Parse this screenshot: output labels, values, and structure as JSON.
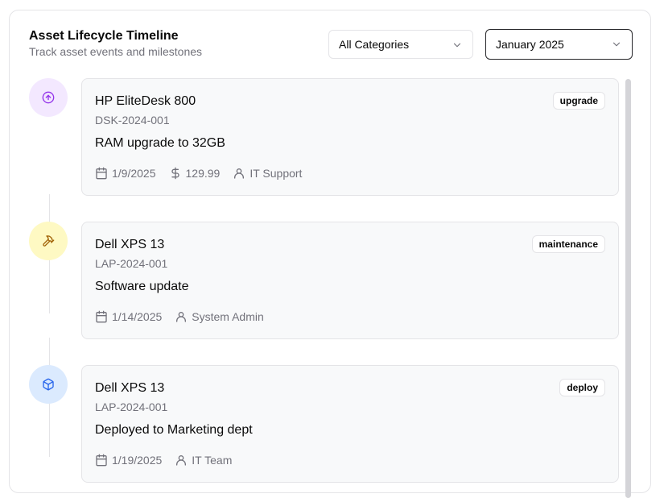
{
  "header": {
    "title": "Asset Lifecycle Timeline",
    "subtitle": "Track asset events and milestones"
  },
  "filters": {
    "category": "All Categories",
    "month": "January 2025"
  },
  "events": [
    {
      "name": "HP EliteDesk 800",
      "code": "DSK-2024-001",
      "description": "RAM upgrade to 32GB",
      "badge": "upgrade",
      "date": "1/9/2025",
      "cost": "129.99",
      "person": "IT Support",
      "icon": "arrow-up-circle-icon",
      "dot_color": "#f3e8ff",
      "icon_color": "#9333ea"
    },
    {
      "name": "Dell XPS 13",
      "code": "LAP-2024-001",
      "description": "Software update",
      "badge": "maintenance",
      "date": "1/14/2025",
      "person": "System Admin",
      "icon": "hammer-icon",
      "dot_color": "#fef9c3",
      "icon_color": "#a16207"
    },
    {
      "name": "Dell XPS 13",
      "code": "LAP-2024-001",
      "description": "Deployed to Marketing dept",
      "badge": "deploy",
      "date": "1/19/2025",
      "person": "IT Team",
      "icon": "box-icon",
      "dot_color": "#dbeafe",
      "icon_color": "#2563eb"
    }
  ]
}
